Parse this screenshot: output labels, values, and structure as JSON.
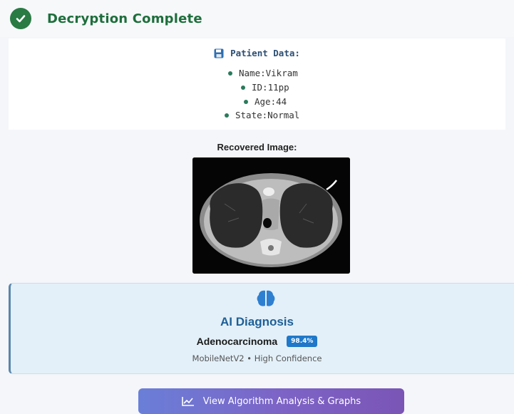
{
  "header": {
    "title": "Decryption Complete",
    "icon": "check-circle-icon",
    "accent": "#2a7a44"
  },
  "patient": {
    "title": "Patient Data:",
    "icon": "floppy-disk-icon",
    "items": [
      "Name:Vikram",
      "ID:11pp",
      "Age:44",
      "State:Normal"
    ]
  },
  "image_section": {
    "label": "Recovered Image:"
  },
  "ai": {
    "icon": "brain-icon",
    "title": "AI Diagnosis",
    "diagnosis": "Adenocarcinoma",
    "confidence": "98.4%",
    "model_line": "MobileNetV2 • High Confidence",
    "accent": "#1f5f96"
  },
  "action": {
    "label": "View Algorithm Analysis & Graphs",
    "icon": "chart-line-icon"
  }
}
